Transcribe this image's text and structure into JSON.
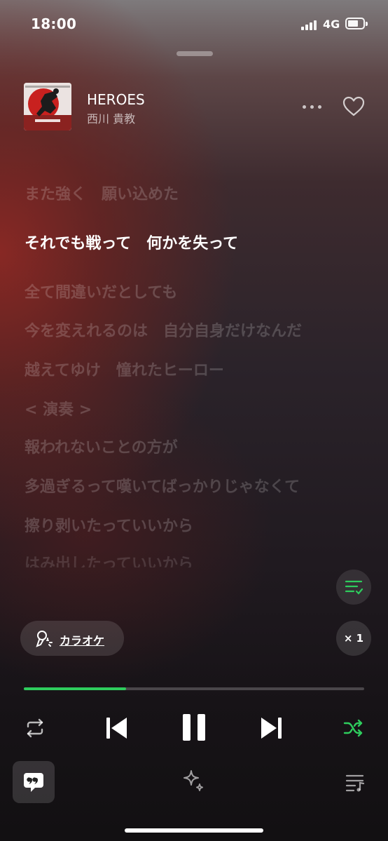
{
  "status_bar": {
    "time": "18:00",
    "network": "4G"
  },
  "track": {
    "title": "HEROES",
    "artist": "西川 貴教"
  },
  "lyrics": {
    "lines": [
      {
        "text": "また強く　願い込めた",
        "active": false
      },
      {
        "text": "それでも戦って　何かを失って",
        "active": true
      },
      {
        "text": "全て間違いだとしても",
        "active": false
      },
      {
        "text": "今を変えれるのは　自分自身だけなんだ",
        "active": false
      },
      {
        "text": "越えてゆけ　憧れたヒーロー",
        "active": false
      },
      {
        "text": "< 演奏 >",
        "active": false
      },
      {
        "text": "報われないことの方が",
        "active": false
      },
      {
        "text": "多過ぎるって嘆いてばっかりじゃなくて",
        "active": false
      },
      {
        "text": "擦り剥いたっていいから",
        "active": false
      },
      {
        "text": "はみ出したっていいから",
        "active": false
      }
    ]
  },
  "karaoke": {
    "label": "カラオケ"
  },
  "speed": {
    "label": "× 1"
  },
  "progress": {
    "fraction": 0.3
  },
  "controls": {
    "repeat_icon": "repeat-icon",
    "prev_icon": "skip-previous-icon",
    "pause_icon": "pause-icon",
    "next_icon": "skip-next-icon",
    "shuffle_icon": "shuffle-icon",
    "accent_color": "#2ecc5d"
  }
}
